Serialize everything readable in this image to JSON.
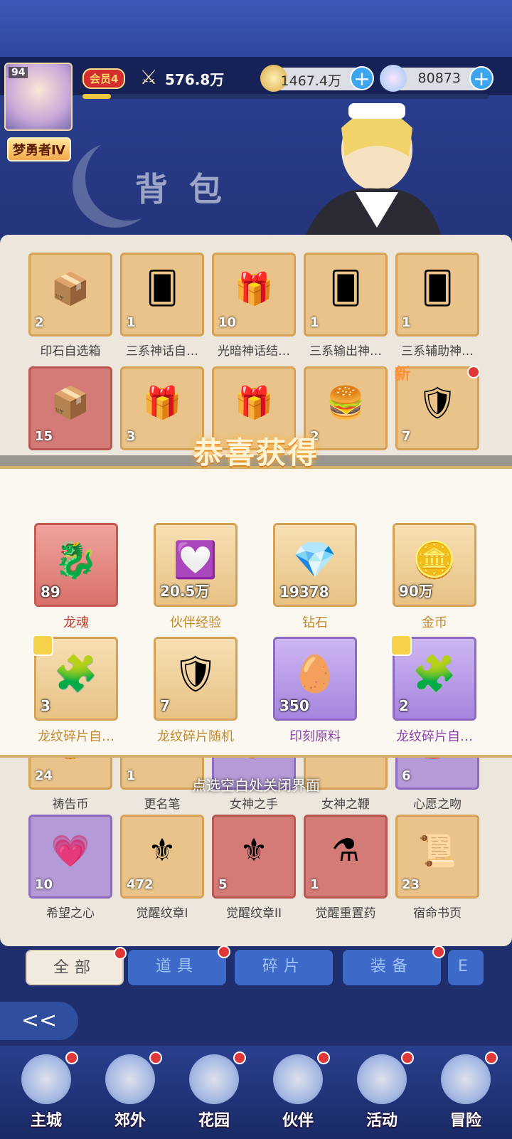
{
  "player": {
    "level": "94",
    "rank": "梦勇者Ⅳ",
    "vip": "会员4",
    "vip_progress": 0.07,
    "power": "576.8万"
  },
  "currency": {
    "gold": "1467.4万",
    "diamonds": "80873"
  },
  "page_title": "背包",
  "bag_items_row1": [
    {
      "label": "印石自选箱",
      "count": "2",
      "glyph": "📦"
    },
    {
      "label": "三系神话自…",
      "count": "1",
      "glyph": "🂠"
    },
    {
      "label": "光暗神话结…",
      "count": "10",
      "glyph": "🎁"
    },
    {
      "label": "三系输出神…",
      "count": "1",
      "glyph": "🂠"
    },
    {
      "label": "三系辅助神…",
      "count": "1",
      "glyph": "🂠"
    }
  ],
  "bag_items_row2": [
    {
      "count": "15",
      "glyph": "📦",
      "style": "red"
    },
    {
      "count": "3",
      "glyph": "🎁"
    },
    {
      "glyph": "🎁"
    },
    {
      "count": "2",
      "glyph": "🍔"
    },
    {
      "count": "7",
      "glyph": "🛡",
      "new": "新"
    }
  ],
  "bag_items_row5": [
    {
      "label": "祷告币",
      "count": "24",
      "glyph": "🪙"
    },
    {
      "label": "更名笔",
      "count": "1",
      "glyph": "✒"
    },
    {
      "label": "女神之手",
      "glyph": "✋",
      "style": "purple"
    },
    {
      "label": "女神之鞭",
      "glyph": "〰"
    },
    {
      "label": "心愿之吻",
      "count": "6",
      "glyph": "💋",
      "style": "purple"
    }
  ],
  "bag_items_row6": [
    {
      "label": "希望之心",
      "count": "10",
      "glyph": "💗",
      "style": "purple"
    },
    {
      "label": "觉醒纹章I",
      "count": "472",
      "glyph": "⚜"
    },
    {
      "label": "觉醒纹章II",
      "count": "5",
      "glyph": "⚜",
      "style": "red"
    },
    {
      "label": "觉醒重置药",
      "count": "1",
      "glyph": "⚗",
      "style": "red"
    },
    {
      "label": "宿命书页",
      "count": "23",
      "glyph": "📜"
    }
  ],
  "reward": {
    "title": "恭喜获得",
    "items": [
      {
        "label": "龙魂",
        "count": "89",
        "glyph": "🐉",
        "style": "red",
        "color": "#c0392b"
      },
      {
        "label": "伙伴经验",
        "count": "20.5万",
        "glyph": "💟",
        "color": "#c28a2c"
      },
      {
        "label": "钻石",
        "count": "19378",
        "glyph": "💎",
        "color": "#c28a2c"
      },
      {
        "label": "金币",
        "count": "90万",
        "glyph": "🪙",
        "color": "#c28a2c"
      },
      {
        "label": "龙纹碎片自…",
        "count": "3",
        "glyph": "🧩",
        "color": "#c28a2c",
        "puzzle": true
      },
      {
        "label": "龙纹碎片随机",
        "count": "7",
        "glyph": "🛡",
        "color": "#c28a2c"
      },
      {
        "label": "印刻原料",
        "count": "350",
        "glyph": "🥚",
        "style": "purple",
        "color": "#8e44ad"
      },
      {
        "label": "龙纹碎片自…",
        "count": "2",
        "glyph": "🧩",
        "style": "purple",
        "color": "#8e44ad",
        "puzzle": true
      }
    ],
    "close_tip": "点选空白处关闭界面"
  },
  "tabs": [
    {
      "label": "全部",
      "active": true,
      "dot": true
    },
    {
      "label": "道具",
      "dot": true
    },
    {
      "label": "碎片",
      "dot": false
    },
    {
      "label": "装备",
      "dot": true
    },
    {
      "label": "E",
      "dot": false
    }
  ],
  "nav": [
    {
      "label": "主城",
      "dot": true
    },
    {
      "label": "郊外",
      "dot": true
    },
    {
      "label": "花园",
      "dot": true
    },
    {
      "label": "伙伴",
      "dot": true
    },
    {
      "label": "活动",
      "dot": true
    },
    {
      "label": "冒险",
      "dot": true
    }
  ]
}
